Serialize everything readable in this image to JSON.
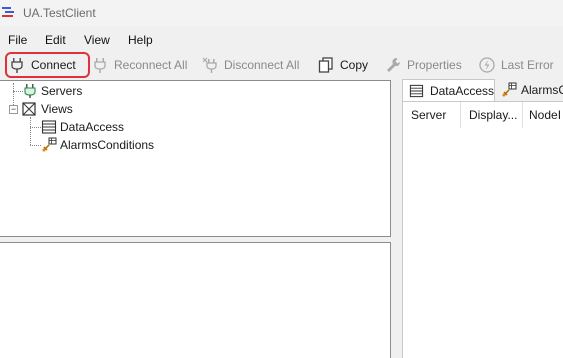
{
  "window": {
    "title": "UA.TestClient",
    "icon": "app-logo-icon"
  },
  "menu": {
    "items": [
      "File",
      "Edit",
      "View",
      "Help"
    ]
  },
  "toolbar": {
    "connect": {
      "label": "Connect",
      "icon": "plug-icon"
    },
    "reconnect_all": {
      "label": "Reconnect All",
      "icon": "plug-icon"
    },
    "disconnect_all": {
      "label": "Disconnect All",
      "icon": "unplug-icon"
    },
    "copy": {
      "label": "Copy",
      "icon": "copy-icon"
    },
    "properties": {
      "label": "Properties",
      "icon": "wrench-icon"
    },
    "last_error": {
      "label": "Last Error",
      "icon": "error-icon"
    },
    "highlight_color": "#e0323c"
  },
  "tree": {
    "servers": {
      "label": "Servers",
      "icon": "server-icon"
    },
    "views": {
      "label": "Views",
      "icon": "views-icon"
    },
    "data_access": {
      "label": "DataAccess",
      "icon": "table-icon"
    },
    "alarms_conditions": {
      "label": "AlarmsConditions",
      "icon": "alarm-icon"
    }
  },
  "tabs": [
    {
      "label": "DataAccess",
      "icon": "table-icon",
      "active": true
    },
    {
      "label": "AlarmsC",
      "icon": "alarm-icon",
      "active": false
    }
  ],
  "table": {
    "columns": [
      "Server",
      "Display...",
      "NodeI"
    ]
  }
}
